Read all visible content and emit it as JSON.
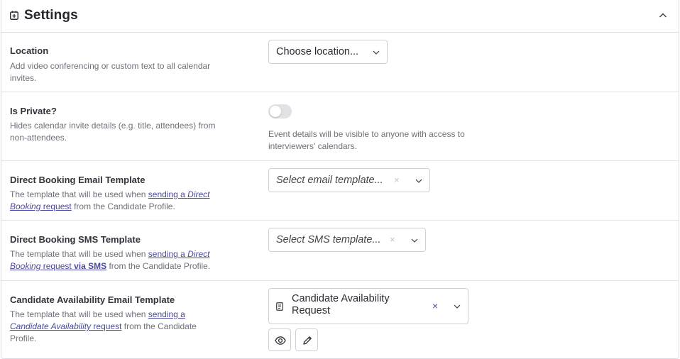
{
  "header": {
    "title": "Settings",
    "icon": "calendar-plus-icon",
    "collapse_icon": "chevron-up-icon"
  },
  "location": {
    "label": "Location",
    "description": "Add video conferencing or custom text to all calendar invites.",
    "select_value": "Choose location..."
  },
  "private": {
    "label": "Is Private?",
    "description": "Hides calendar invite details (e.g. title, attendees) from non-attendees.",
    "toggle_on": false,
    "helper": "Event details will be visible to anyone with access to interviewers' calendars."
  },
  "email_template": {
    "label": "Direct Booking Email Template",
    "desc_prefix": "The template that will be used when ",
    "link_part1": "sending a ",
    "link_part2": "Direct Booking",
    "link_part3": " request",
    "desc_suffix": " from the Candidate Profile.",
    "placeholder": "Select email template...",
    "clear": "×"
  },
  "sms_template": {
    "label": "Direct Booking SMS Template",
    "desc_prefix": "The template that will be used when ",
    "link_part1": "sending a ",
    "link_part2": "Direct Booking",
    "link_part3": " request ",
    "link_part4": "via SMS",
    "desc_suffix": " from the Candidate Profile.",
    "placeholder": "Select SMS template...",
    "clear": "×"
  },
  "availability_template": {
    "label": "Candidate Availability Email Template",
    "desc_prefix": "The template that will be used when ",
    "link_part1": "sending a ",
    "link_part2": "Candidate Availability",
    "link_part3": " request",
    "desc_suffix": " from the Candidate Profile.",
    "selected": "Candidate Availability Request",
    "clear": "×",
    "preview_icon": "eye-icon",
    "edit_icon": "pencil-icon"
  },
  "colors": {
    "link": "#4b4a9e",
    "border": "#cfd0d6",
    "muted_text": "#6f7079"
  }
}
